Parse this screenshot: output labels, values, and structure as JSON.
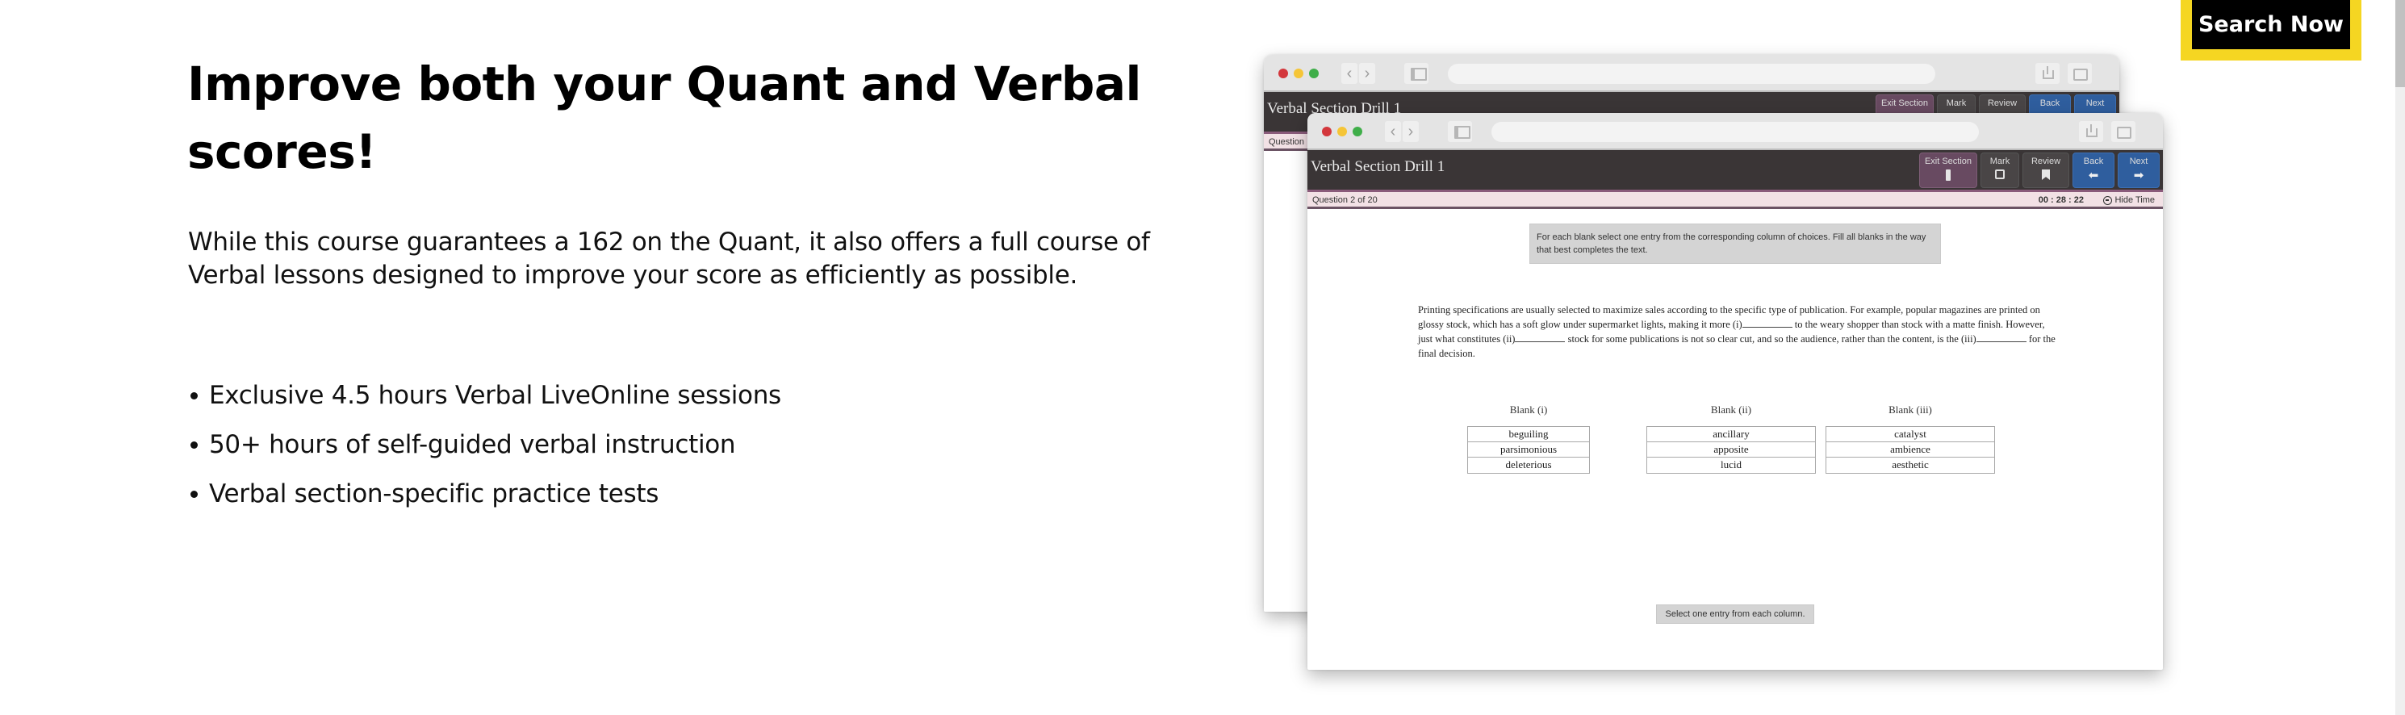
{
  "hero": {
    "headline": "Improve both your Quant and Verbal scores!",
    "intro": "While this course guarantees a 162 on the Quant, it also offers a full course of Verbal lessons designed to improve your score as efficiently as possible.",
    "bullets": [
      "Exclusive 4.5 hours Verbal LiveOnline sessions",
      "50+ hours of self-guided verbal instruction",
      "Verbal section-specific practice tests"
    ]
  },
  "cta": {
    "label": "Search Now",
    "frame_color": "#f5d622",
    "button_color": "#000000"
  },
  "screenshot": {
    "browser": {
      "nav_back": "‹",
      "nav_forward": "›",
      "icons": [
        "back-icon",
        "forward-icon",
        "sidebar-icon",
        "share-icon",
        "tabs-icon"
      ]
    },
    "back_window": {
      "title": "Verbal Section Drill 1",
      "question_label": "Question"
    },
    "front_window": {
      "title": "Verbal Section Drill 1",
      "toolbar": {
        "exit_section": "Exit Section",
        "mark": "Mark",
        "review": "Review",
        "back": "Back",
        "next": "Next"
      },
      "question_label": "Question 2 of 20",
      "timer": "00 : 28 : 22",
      "hide_time": "Hide Time",
      "instructions": "For each blank select one entry from the corresponding column of choices. Fill all blanks in the way that best completes the text.",
      "passage": {
        "part1": "Printing specifications are usually selected to maximize sales according to the specific type of publication. For example, popular magazines are printed on glossy stock, which has a soft glow under supermarket lights, making it more (i)",
        "part2": " to the weary shopper than stock with a matte finish. However, just what constitutes (ii)",
        "part3": " stock for some publications is not so clear cut, and so the audience, rather than the content, is the (iii)",
        "part4": " for the final decision."
      },
      "blanks": [
        {
          "header": "Blank (i)",
          "options": [
            "beguiling",
            "parsimonious",
            "deleterious"
          ]
        },
        {
          "header": "Blank (ii)",
          "options": [
            "ancillary",
            "apposite",
            "lucid"
          ]
        },
        {
          "header": "Blank (iii)",
          "options": [
            "catalyst",
            "ambience",
            "aesthetic"
          ]
        }
      ],
      "status_hint": "Select one entry from each column."
    }
  }
}
